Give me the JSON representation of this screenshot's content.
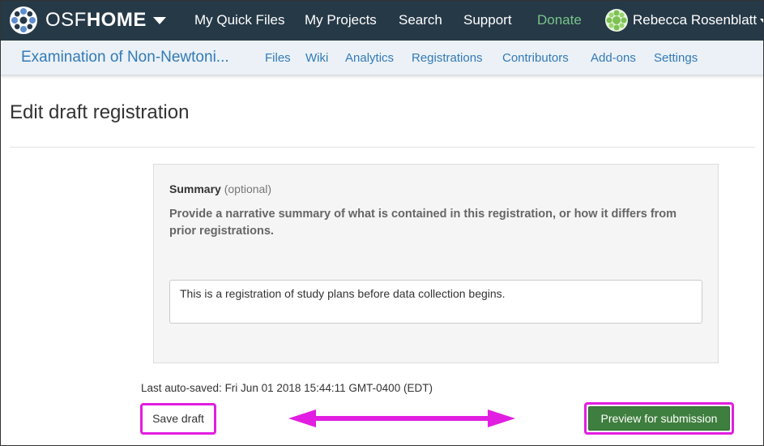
{
  "topnav": {
    "brand_osf": "OSF",
    "brand_home": "HOME",
    "links": [
      "My Quick Files",
      "My Projects",
      "Search",
      "Support"
    ],
    "donate": "Donate",
    "user_name": "Rebecca Rosenblatt",
    "background": "#263947",
    "donate_color": "#78c48a"
  },
  "subnav": {
    "project_title": "Examination of Non-Newtoni...",
    "links": [
      "Files",
      "Wiki",
      "Analytics",
      "Registrations",
      "Contributors",
      "Add-ons",
      "Settings"
    ],
    "link_color": "#337ab7"
  },
  "page": {
    "title": "Edit draft registration"
  },
  "question": {
    "title": "Summary",
    "optional": "(optional)",
    "description": "Provide a narrative summary of what is contained in this registration, or how it differs from prior registrations.",
    "answer": "This is a registration of study plans before data collection begins."
  },
  "footer": {
    "autosave": "Last auto-saved: Fri Jun 01 2018 15:44:11 GMT-0400 (EDT)",
    "save_label": "Save draft",
    "preview_label": "Preview for submission",
    "highlight_color": "#e11ee1",
    "preview_color": "#3e7e3e"
  },
  "icons": {
    "brand": "osf-logo-icon",
    "brand_caret": "caret-down-icon",
    "avatar": "user-avatar-icon",
    "user_caret": "caret-down-icon",
    "annotation_arrow": "double-arrow-icon"
  }
}
